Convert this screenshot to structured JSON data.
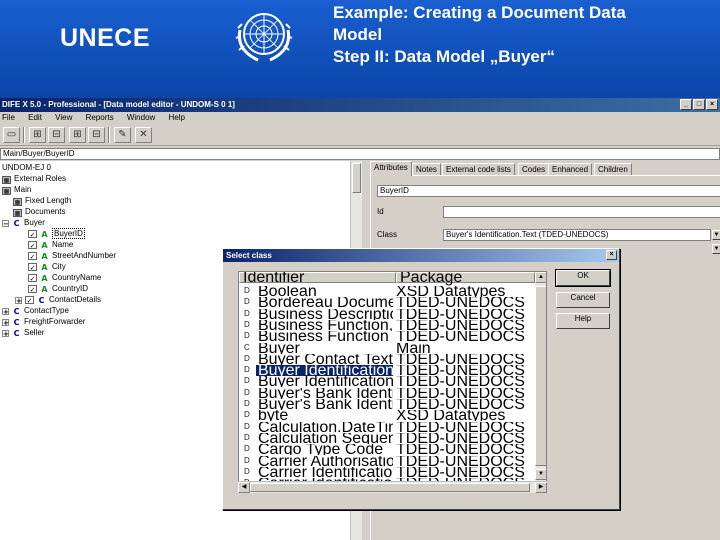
{
  "slide": {
    "org": "UNECE",
    "title_lines": [
      "Example: Creating a Document Data",
      "Model",
      "Step II: Data Model „Buyer“"
    ]
  },
  "app": {
    "window_title": "DIFE X 5.0 - Professional - [Data model editor - UNDOM-S 0 1]",
    "menu": [
      "File",
      "Edit",
      "View",
      "Reports",
      "Window",
      "Help"
    ],
    "path": "Main/Buyer/BuyerID"
  },
  "tree": {
    "items": [
      {
        "label": "UNDOM-EJ 0",
        "icon": "none"
      },
      {
        "label": "External Roles",
        "icon": "box"
      },
      {
        "label": "Main",
        "icon": "box"
      },
      {
        "label": "Fixed Length",
        "icon": "box"
      },
      {
        "label": "Documents",
        "icon": "box"
      },
      {
        "label": "Buyer",
        "icon": "class"
      },
      {
        "label": "BuyerID",
        "icon": "attr"
      },
      {
        "label": "Name",
        "icon": "attr"
      },
      {
        "label": "StreetAndNumber",
        "icon": "attr"
      },
      {
        "label": "City",
        "icon": "attr"
      },
      {
        "label": "CountryName",
        "icon": "attr"
      },
      {
        "label": "CountryID",
        "icon": "attr"
      },
      {
        "label": "ContactDetails",
        "icon": "class"
      },
      {
        "label": "ContactType",
        "icon": "class"
      },
      {
        "label": "FreightForwarder",
        "icon": "class"
      },
      {
        "label": "Seller",
        "icon": "class"
      }
    ]
  },
  "panel": {
    "tabs": [
      "Attributes",
      "Notes",
      "External code lists",
      "Codes",
      "Enhanced",
      "Children"
    ],
    "name_value": "BuyerID",
    "id_label": "Id",
    "class_label": "Class",
    "class_value": "Buyer's Identification.Text (TDED-UNEDOCS)"
  },
  "dialog": {
    "title": "Select class",
    "col_identifier": "Identifier",
    "col_package": "Package",
    "buttons": {
      "ok": "OK",
      "cancel": "Cancel",
      "help": "Help"
    },
    "rows": [
      {
        "kind": "D",
        "name": "Boolean",
        "pkg": "XSD Datatypes"
      },
      {
        "kind": "D",
        "name": "Bordereau Document Identification ...",
        "pkg": "TDED-UNEDOCS"
      },
      {
        "kind": "D",
        "name": "Business Description Text",
        "pkg": "TDED-UNEDOCS"
      },
      {
        "kind": "D",
        "name": "Business Function, Type Code",
        "pkg": "TDED-UNEDOCS"
      },
      {
        "kind": "D",
        "name": "Business Function Code",
        "pkg": "TDED-UNEDOCS"
      },
      {
        "kind": "C",
        "name": "Buyer",
        "pkg": "Main"
      },
      {
        "kind": "D",
        "name": "Buyer Contact Text",
        "pkg": "TDED-UNEDOCS"
      },
      {
        "kind": "D",
        "name": "Buyer Identification.Identifier",
        "pkg": "TDED-UNEDOCS",
        "selected": true
      },
      {
        "kind": "D",
        "name": "Buyer Identification Text",
        "pkg": "TDED-UNEDOCS"
      },
      {
        "kind": "D",
        "name": "Buyer's Bank Identification Identifier",
        "pkg": "TDED-UNEDOCS"
      },
      {
        "kind": "D",
        "name": "Buyer's Bank Identification Text",
        "pkg": "TDED-UNEDOCS"
      },
      {
        "kind": "D",
        "name": "byte",
        "pkg": "XSD Datatypes"
      },
      {
        "kind": "D",
        "name": "Calculation.DateTime",
        "pkg": "TDED-UNEDOCS"
      },
      {
        "kind": "D",
        "name": "Calculation Sequence Code",
        "pkg": "TDED-UNEDOCS"
      },
      {
        "kind": "D",
        "name": "Cargo Type Code",
        "pkg": "TDED-UNEDOCS"
      },
      {
        "kind": "D",
        "name": "Carrier Authorisation Text",
        "pkg": "TDED-UNEDOCS"
      },
      {
        "kind": "D",
        "name": "Carrier Identification Identifier",
        "pkg": "TDED-UNEDOCS"
      },
      {
        "kind": "D",
        "name": "Carrier Identification Text",
        "pkg": "TDED-UNEDOCS"
      }
    ]
  },
  "colors": {
    "header_blue": "#1556c4",
    "selection": "#0a246a",
    "window_face": "#d4d0c8"
  }
}
